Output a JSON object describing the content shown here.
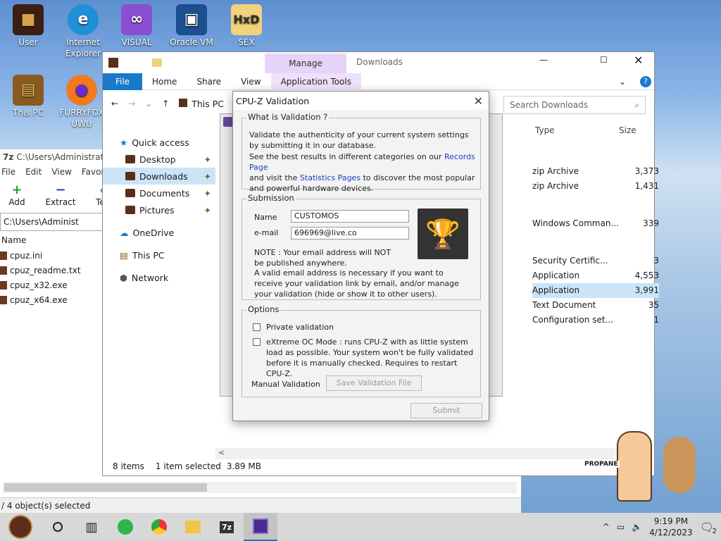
{
  "desktop": {
    "icons": [
      {
        "label": "User",
        "glyph": "■"
      },
      {
        "label": "Internet Explorer",
        "glyph": "e"
      },
      {
        "label": "VISUAL",
        "glyph": "∞"
      },
      {
        "label": "Oracle VM",
        "glyph": "▣"
      },
      {
        "label": "SEX",
        "glyph": "HxD"
      },
      {
        "label": "This PC",
        "glyph": "▤"
      },
      {
        "label": "FURRYFOX UWU",
        "glyph": "●"
      }
    ]
  },
  "zip": {
    "title": "C:\\Users\\Administrato",
    "menu": [
      "File",
      "Edit",
      "View",
      "Favorit"
    ],
    "tools": [
      {
        "label": "Add",
        "glyph": "+"
      },
      {
        "label": "Extract",
        "glyph": "−"
      },
      {
        "label": "Test",
        "glyph": "✔"
      }
    ],
    "address": "C:\\Users\\Administ",
    "column_name": "Name",
    "files": [
      "cpuz.ini",
      "cpuz_readme.txt",
      "cpuz_x32.exe",
      "cpuz_x64.exe"
    ],
    "status": "/ 4 object(s) selected"
  },
  "explorer": {
    "context_tab": "Manage",
    "title": "Downloads",
    "ribbon_tabs": [
      "File",
      "Home",
      "Share",
      "View",
      "Application Tools"
    ],
    "path": "This PC",
    "search_placeholder": "Search Downloads",
    "nav": {
      "quick_access": "Quick access",
      "items": [
        "Desktop",
        "Downloads",
        "Documents",
        "Pictures"
      ],
      "onedrive": "OneDrive",
      "this_pc": "This PC",
      "network": "Network"
    },
    "columns": {
      "type": "Type",
      "size": "Size"
    },
    "rows": [
      {
        "type": "zip Archive",
        "size": "3,373"
      },
      {
        "type": "zip Archive",
        "size": "1,431"
      },
      {
        "type": "Windows Comman...",
        "size": "339"
      },
      {
        "type": "Security Certific...",
        "size": "3"
      },
      {
        "type": "Application",
        "size": "4,553"
      },
      {
        "type": "Application",
        "size": "3,991"
      },
      {
        "type": "Text Document",
        "size": "35"
      },
      {
        "type": "Configuration set...",
        "size": "1"
      }
    ],
    "status": {
      "items": "8 items",
      "selected": "1 item selected",
      "size": "3.89 MB"
    }
  },
  "dialog": {
    "title": "CPU-Z Validation",
    "what_title": "What is Validation ?",
    "what_text1": "Validate the authenticity of your current system settings by submitting it in our database.",
    "what_text2a": "See the best results in different categories on our",
    "records_link": "Records Page",
    "what_text2b": "and visit the",
    "stats_link": "Statistics Pages",
    "what_text2c": "to discover the most popular and powerful hardware devices.",
    "submission_title": "Submission",
    "name_label": "Name",
    "name_value": "CUSTOMOS",
    "email_label": "e-mail",
    "email_value": "696969@live.co",
    "note1": "NOTE : Your email address will NOT be published anywhere.",
    "note2": "A valid email address is necessary if you want to receive your validation link by email, and/or manage your validation (hide or show it to other users).",
    "options_title": "Options",
    "opt_private": "Private validation",
    "opt_extreme": "eXtreme OC Mode : runs CPU-Z with as little system load as possible. Your system won't be fully validated before it is manually checked. Requires to restart CPU-Z.",
    "manual_label": "Manual Validation",
    "save_button": "Save Validation File",
    "submit_button": "Submit"
  },
  "sticker_label": "PROPANE",
  "taskbar": {
    "time": "9:19 PM",
    "date": "4/12/2023",
    "notification_count": "2"
  },
  "colors": {
    "accent": "#1979ca",
    "manage_tab": "#e7d3f7",
    "selection": "#cce4f7"
  }
}
